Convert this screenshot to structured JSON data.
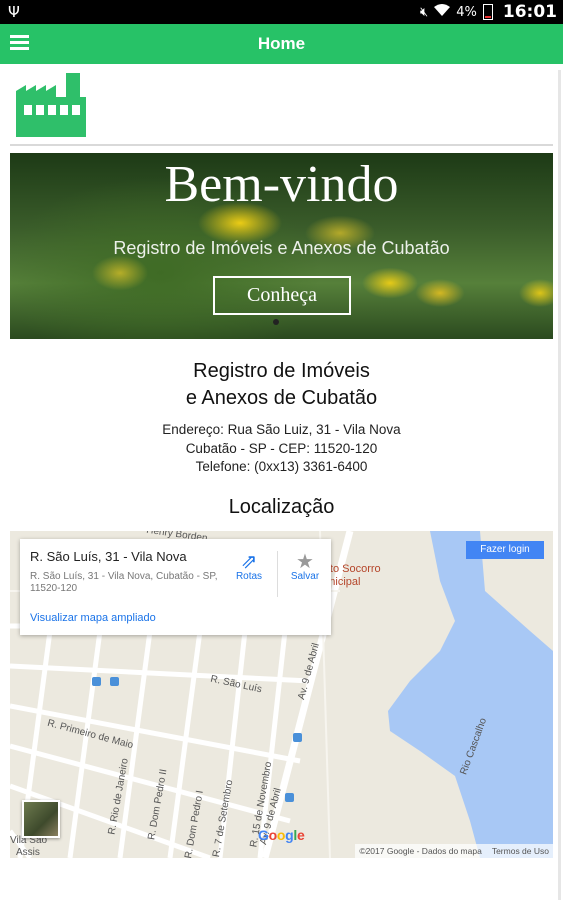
{
  "status_bar": {
    "battery": "4%",
    "time": "16:01"
  },
  "app_bar": {
    "title": "Home"
  },
  "banner": {
    "heading": "Bem-vindo",
    "subheading": "Registro de Imóveis e Anexos de Cubatão",
    "button_label": "Conheça"
  },
  "org": {
    "line1": "Registro de Imóveis",
    "line2": "e Anexos de Cubatão"
  },
  "contact": {
    "address": "Endereço: Rua São Luiz, 31 - Vila Nova",
    "city": "Cubatão - SP - CEP: 11520-120",
    "phone": "Telefone: (0xx13) 3361-6400"
  },
  "location": {
    "title": "Localização"
  },
  "map": {
    "popup_title": "R. São Luís, 31 - Vila Nova",
    "popup_address": "R. São Luís, 31 - Vila Nova, Cubatão - SP, 11520-120",
    "popup_link": "Visualizar mapa ampliado",
    "route_label": "Rotas",
    "save_label": "Salvar",
    "login_label": "Fazer login",
    "poi_line1": "ronto Socorro",
    "poi_line2": "Municipal",
    "streets": {
      "sao_luis": "R. São Luís",
      "av_9_abril_top": "Av. 9 de Abril",
      "av_9_abril_bottom": "Av. 9 de Abril",
      "primeiro_maio": "R. Primeiro de Maio",
      "rio_janeiro": "R. Rio de Janeiro",
      "dom_pedro_ii": "R. Dom Pedro II",
      "dom_pedro_i": "R. Dom Pedro I",
      "sete_setembro": "R. 7 de Setembro",
      "novembro": "R. 15 de Novembro",
      "rio_cascalho": "Rio Cascalho",
      "henry": "Henry Borden",
      "vila_sao": "Vila São",
      "assis": "Assis"
    },
    "google_logo": "Google",
    "copyright": "©2017 Google - Dados do mapa",
    "terms": "Termos de Uso"
  },
  "colors": {
    "brand_green": "#27c267",
    "map_water": "#a8c8f5",
    "link_blue": "#1a73e8"
  }
}
